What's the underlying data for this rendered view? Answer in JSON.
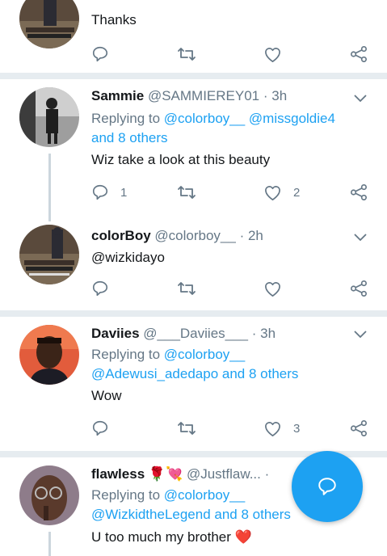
{
  "tweets": [
    {
      "body": "Thanks",
      "actions": {
        "reply": "",
        "retweet": "",
        "like": ""
      }
    },
    {
      "name": "Sammie",
      "handle": "@SAMMIEREY01",
      "time": "· 3h",
      "replying_prefix": "Replying to ",
      "replying_users": "@colorboy__ @missgoldie4",
      "replying_more": "and 8 others",
      "body": "Wiz take a look at this beauty",
      "actions": {
        "reply": "1",
        "retweet": "",
        "like": "2"
      }
    },
    {
      "name": "colorBoy",
      "handle": "@colorboy__",
      "time": "· 2h",
      "body_link": "@wizkidayo",
      "actions": {
        "reply": "",
        "retweet": "",
        "like": ""
      }
    },
    {
      "name": "Daviies",
      "handle": "@___Daviies___",
      "time": "· 3h",
      "replying_prefix": "Replying to ",
      "replying_users": "@colorboy__",
      "replying_line2": "@Adewusi_adedapo and 8 others",
      "body": "Wow",
      "actions": {
        "reply": "",
        "retweet": "",
        "like": "3"
      }
    },
    {
      "name": "flawless",
      "emoji": "🌹💘",
      "handle": "@Justflaw...",
      "time": "·",
      "replying_prefix": "Replying to ",
      "replying_users": "@colorboy__",
      "replying_line2": "@WizkidtheLegend and 8 others",
      "body": "U too much my brother",
      "emoji_heart": "❤️"
    }
  ],
  "colors": {
    "accent": "#1da1f2",
    "muted": "#657786",
    "divider": "#e6ecf0",
    "heart": "#e0245e"
  },
  "icons": {
    "reply": "reply-icon",
    "retweet": "retweet-icon",
    "like": "like-icon",
    "share": "share-icon",
    "compose": "compose-reply-icon"
  }
}
